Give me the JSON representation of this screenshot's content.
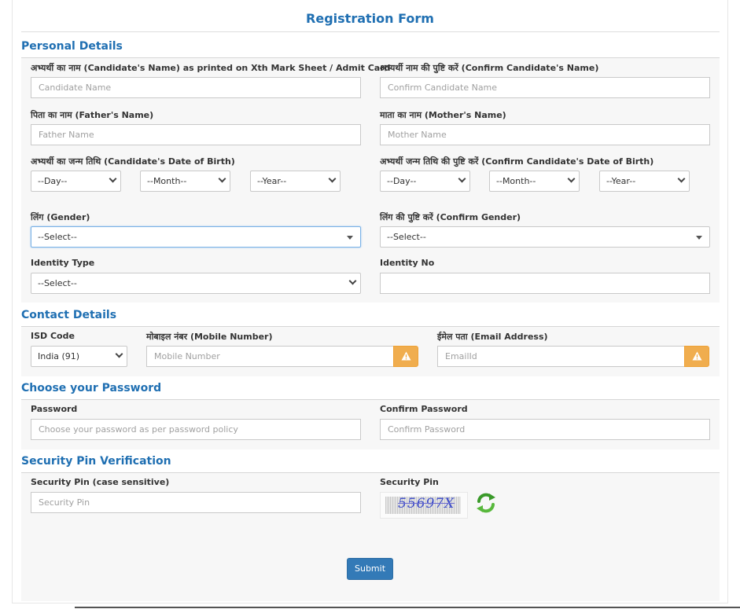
{
  "title": "Registration Form",
  "personal": {
    "heading": "Personal Details",
    "candidate_name_label": "अभ्यर्थी का नाम (Candidate's Name) as printed on Xth Mark Sheet / Admit Card",
    "candidate_name_placeholder": "Candidate Name",
    "confirm_name_label": "अभ्यर्थी नाम की पुष्टि करें (Confirm Candidate's Name)",
    "confirm_name_placeholder": "Confirm Candidate Name",
    "father_label": "पिता का नाम (Father's Name)",
    "father_placeholder": "Father Name",
    "mother_label": "माता का नाम (Mother's Name)",
    "mother_placeholder": "Mother Name",
    "dob_label": "अभ्यर्थी का जन्म तिथि (Candidate's Date of Birth)",
    "confirm_dob_label": "अभ्यर्थी जन्म तिथि की पुष्टि करें (Confirm Candidate's Date of Birth)",
    "day": "--Day--",
    "month": "--Month--",
    "year": "--Year--",
    "gender_label": "लिंग (Gender)",
    "confirm_gender_label": "लिंग की पुष्टि करें (Confirm Gender)",
    "select": "--Select--",
    "identity_type_label": "Identity Type",
    "identity_no_label": "Identity No"
  },
  "contact": {
    "heading": "Contact Details",
    "isd_label": "ISD Code",
    "isd_value": "India (91)",
    "mobile_label": "मोबाइल नंबर (Mobile Number)",
    "mobile_placeholder": "Mobile Number",
    "email_label": "ईमेल पता (Email Address)",
    "email_placeholder": "EmailId"
  },
  "password": {
    "heading": "Choose your Password",
    "password_label": "Password",
    "password_placeholder": "Choose your password as per password policy",
    "confirm_label": "Confirm Password",
    "confirm_placeholder": "Confirm Password"
  },
  "security": {
    "heading": "Security Pin Verification",
    "pin_label": "Security Pin (case sensitive)",
    "pin_placeholder": "Security Pin",
    "captcha_label": "Security Pin",
    "captcha_text": "55697X"
  },
  "submit_label": "Submit",
  "icons": {
    "warning": "warning-icon",
    "refresh": "refresh-icon",
    "dropdown": "chevron-down-icon"
  },
  "colors": {
    "heading": "#1f6fb2",
    "warning": "#f0ad4e",
    "primary_button": "#337ab7"
  }
}
